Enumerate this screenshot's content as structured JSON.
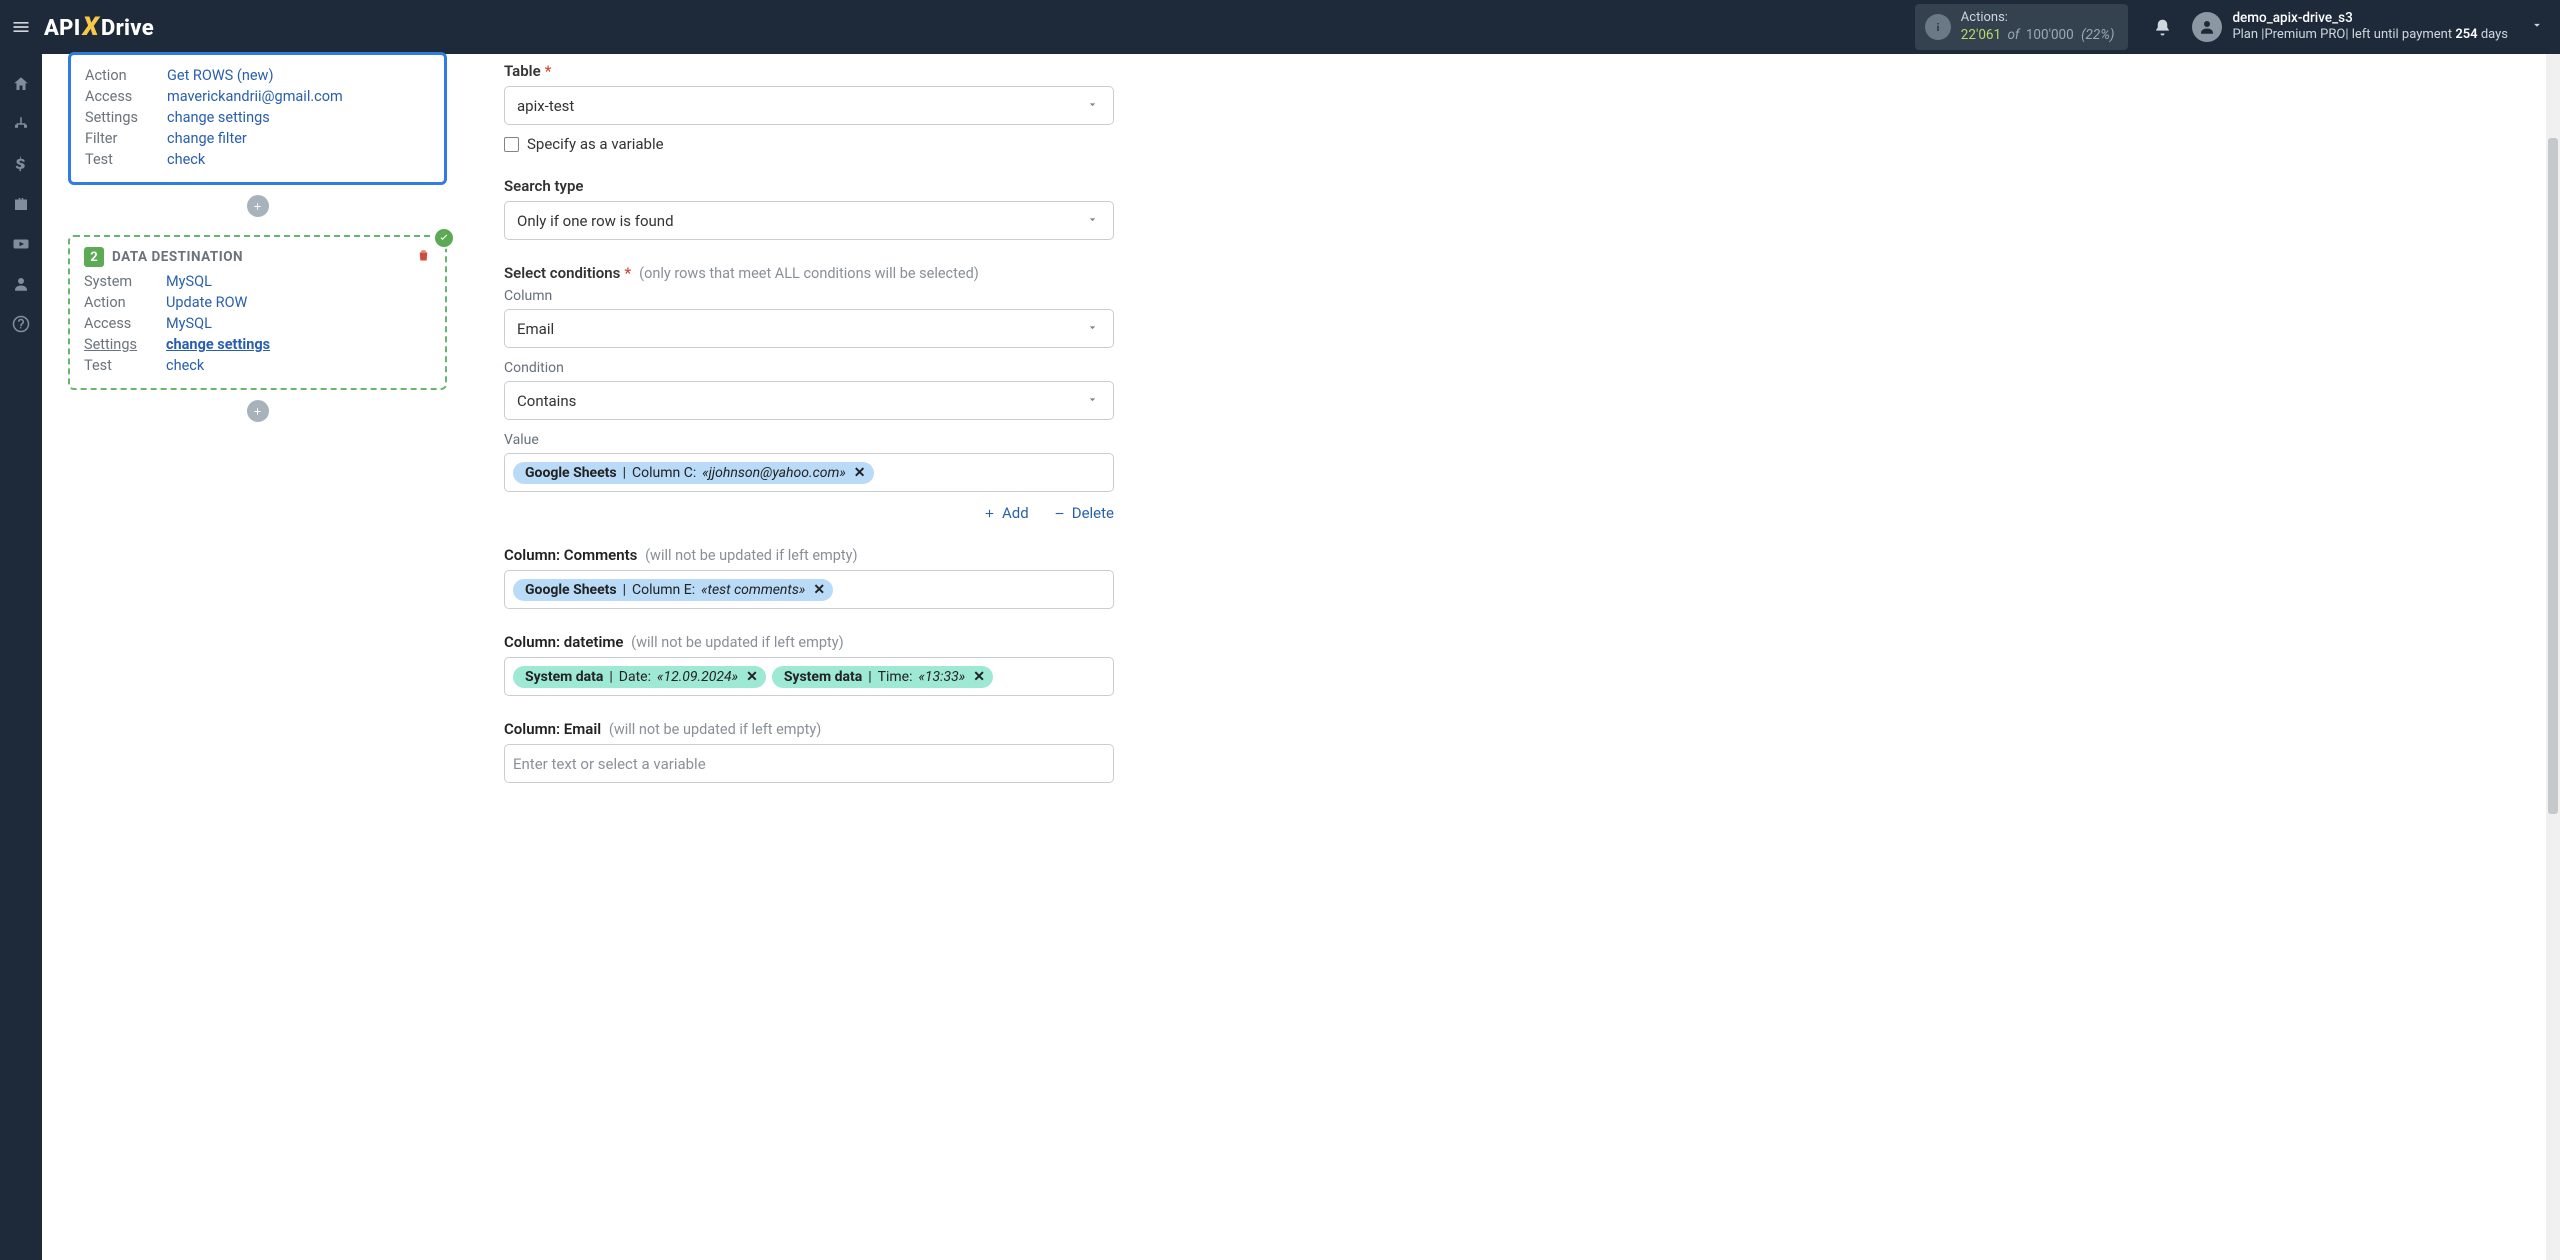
{
  "brand": {
    "pre": "API",
    "x": "X",
    "post": "Drive"
  },
  "header": {
    "actions_label": "Actions:",
    "actions_count": "22'061",
    "actions_of": "of",
    "actions_limit": "100'000",
    "actions_pct": "(22%)",
    "user_name": "demo_apix-drive_s3",
    "plan_prefix": "Plan |Premium PRO| left until payment ",
    "plan_days": "254",
    "plan_suffix": " days"
  },
  "leftnav": [
    "home",
    "sitemap",
    "dollar",
    "briefcase",
    "youtube",
    "user",
    "help"
  ],
  "source_card": {
    "rows": [
      {
        "k": "Action",
        "v": "Get ROWS (new)"
      },
      {
        "k": "Access",
        "v": "maverickandrii@gmail.com"
      },
      {
        "k": "Settings",
        "v": "change settings"
      },
      {
        "k": "Filter",
        "v": "change filter"
      },
      {
        "k": "Test",
        "v": "check"
      }
    ]
  },
  "dest_card": {
    "step": "2",
    "title": "DATA DESTINATION",
    "rows": [
      {
        "k": "System",
        "v": "MySQL"
      },
      {
        "k": "Action",
        "v": "Update ROW"
      },
      {
        "k": "Access",
        "v": "MySQL"
      },
      {
        "k": "Settings",
        "v": "change settings",
        "active": true
      },
      {
        "k": "Test",
        "v": "check"
      }
    ]
  },
  "form": {
    "table_label": "Table",
    "table_value": "apix-test",
    "specify_label": "Specify as a variable",
    "search_type_label": "Search type",
    "search_type_value": "Only if one row is found",
    "select_cond_label": "Select conditions",
    "select_cond_hint": "(only rows that meet ALL conditions will be selected)",
    "column_label": "Column",
    "column_value": "Email",
    "condition_label": "Condition",
    "condition_value": "Contains",
    "value_label": "Value",
    "value_chip": {
      "src": "Google Sheets",
      "col": "Column C:",
      "val": "«jjohnson@yahoo.com»"
    },
    "add_label": "Add",
    "delete_label": "Delete",
    "col_hint": "(will not be updated if left empty)",
    "col_comments": "Column: Comments",
    "comments_chip": {
      "src": "Google Sheets",
      "col": "Column E:",
      "val": "«test comments»"
    },
    "col_datetime": "Column: datetime",
    "dt_chip1": {
      "src": "System data",
      "col": "Date:",
      "val": "«12.09.2024»"
    },
    "dt_chip2": {
      "src": "System data",
      "col": "Time:",
      "val": "«13:33»"
    },
    "col_email": "Column: Email",
    "email_placeholder": "Enter text or select a variable"
  }
}
